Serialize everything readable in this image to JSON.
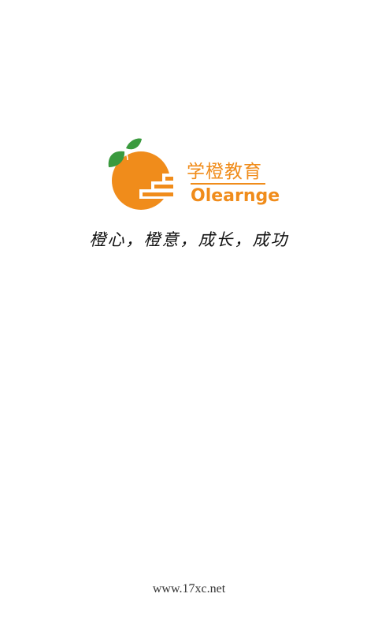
{
  "splash": {
    "brand_cn": "学橙教育",
    "brand_en": "Olearnge",
    "slogan": "橙心，橙意，成长，成功",
    "footer_url": "www.17xc.net",
    "icons": {
      "logo": "orange-stairs-logo-icon"
    },
    "colors": {
      "brand_orange": "#f08c1b",
      "leaf_green": "#3a9a3e",
      "background": "#ffffff"
    }
  }
}
